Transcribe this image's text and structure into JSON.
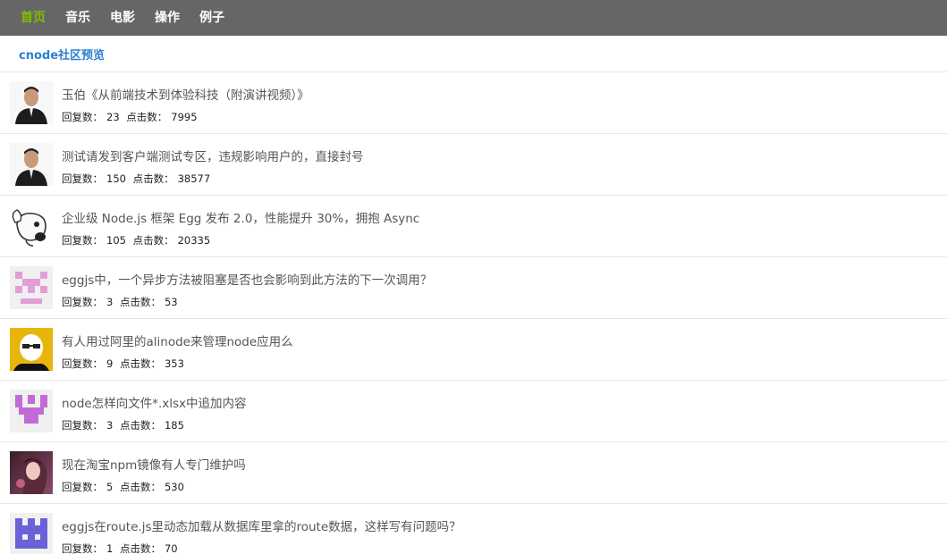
{
  "nav": {
    "items": [
      "首页",
      "音乐",
      "电影",
      "操作",
      "例子"
    ]
  },
  "header": {
    "title": "cnode社区预览"
  },
  "meta_labels": {
    "replies": "回复数：",
    "visits": "点击数："
  },
  "topics": [
    {
      "title": "玉伯《从前端技术到体验科技（附演讲视频）》",
      "replies": "23",
      "visits": "7995",
      "avatar": "person-photo-avatar"
    },
    {
      "title": "测试请发到客户端测试专区，违规影响用户的，直接封号",
      "replies": "150",
      "visits": "38577",
      "avatar": "person-photo-avatar"
    },
    {
      "title": "企业级 Node.js 框架 Egg 发布 2.0，性能提升 30%，拥抱 Async",
      "replies": "105",
      "visits": "20335",
      "avatar": "dog-avatar"
    },
    {
      "title": "eggjs中，一个异步方法被阻塞是否也会影响到此方法的下一次调用？",
      "replies": "3",
      "visits": "53",
      "avatar": "pink-identicon-avatar"
    },
    {
      "title": "有人用过阿里的alinode来管理node应用么",
      "replies": "9",
      "visits": "353",
      "avatar": "bald-man-cartoon-avatar"
    },
    {
      "title": "node怎样向文件*.xlsx中追加内容",
      "replies": "3",
      "visits": "185",
      "avatar": "purple-identicon-avatar"
    },
    {
      "title": "现在淘宝npm镜像有人专门维护吗",
      "replies": "5",
      "visits": "530",
      "avatar": "anime-girl-avatar"
    },
    {
      "title": "eggjs在route.js里动态加载从数据库里拿的route数据，这样写有问题吗？",
      "replies": "1",
      "visits": "70",
      "avatar": "blue-identicon-avatar"
    }
  ],
  "colors": {
    "nav_bg": "#666666",
    "nav_active": "#80bd01",
    "header_link": "#2c7fd1"
  }
}
